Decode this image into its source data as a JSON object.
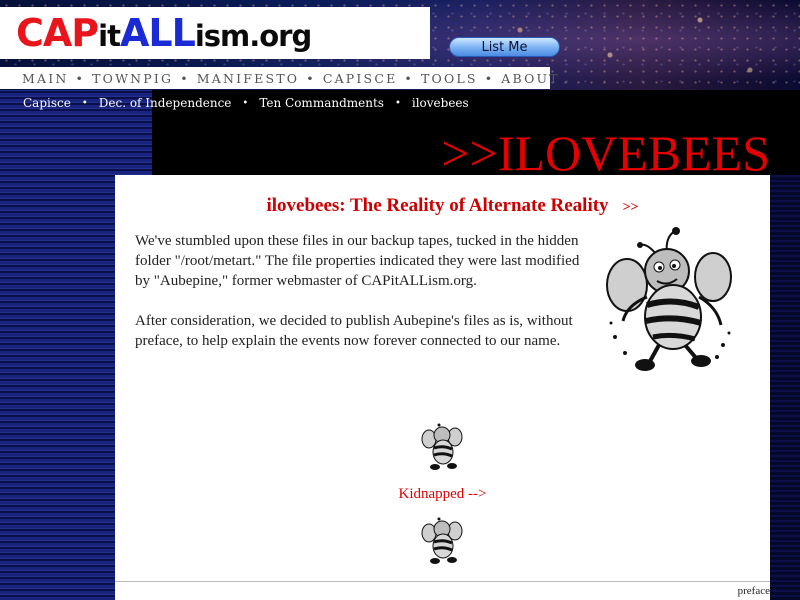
{
  "header": {
    "logo_parts": [
      {
        "text": "CAP",
        "color": "red"
      },
      {
        "text": "it",
        "color": "dark"
      },
      {
        "text": "ALL",
        "color": "blue"
      },
      {
        "text": "ism.org",
        "color": "dark"
      }
    ],
    "logo_prefix": "CAP",
    "logo_it": "it",
    "logo_all": "ALL",
    "logo_suffix": "ism.org",
    "list_me_label": "List Me"
  },
  "nav": {
    "items": [
      "MAIN",
      "TOWNPIG",
      "MANIFESTO",
      "CAPISCE",
      "TOOLS",
      "ABOUT"
    ],
    "separator": "•"
  },
  "breadcrumb": {
    "items": [
      "Capisce",
      "Dec. of Independence",
      "Ten Commandments",
      "ilovebees"
    ],
    "separator": "•"
  },
  "page_title": ">>ILOVEBEES",
  "article": {
    "heading": "ilovebees: The Reality of Alternate Reality",
    "heading_arrow": ">>",
    "paragraph_1": "We've stumbled upon these files in our backup tapes, tucked in the hidden folder \"/root/metart.\" The file properties indicated they were last modified by \"Aubepine,\" former webmaster of CAPitALLism.org.",
    "paragraph_2": "After consideration, we decided to publish Aubepine's files as is, without preface, to help explain the events now forever connected to our name.",
    "kidnapped_link": "Kidnapped -->"
  },
  "footer": {
    "preface_link": "preface"
  },
  "colors": {
    "accent_red": "#e00000",
    "logo_red": "#e8161c",
    "logo_blue": "#1a2ad4",
    "button_blue": "#79b1f2"
  },
  "icons": [
    "bee-icon",
    "bee-small-icon"
  ]
}
